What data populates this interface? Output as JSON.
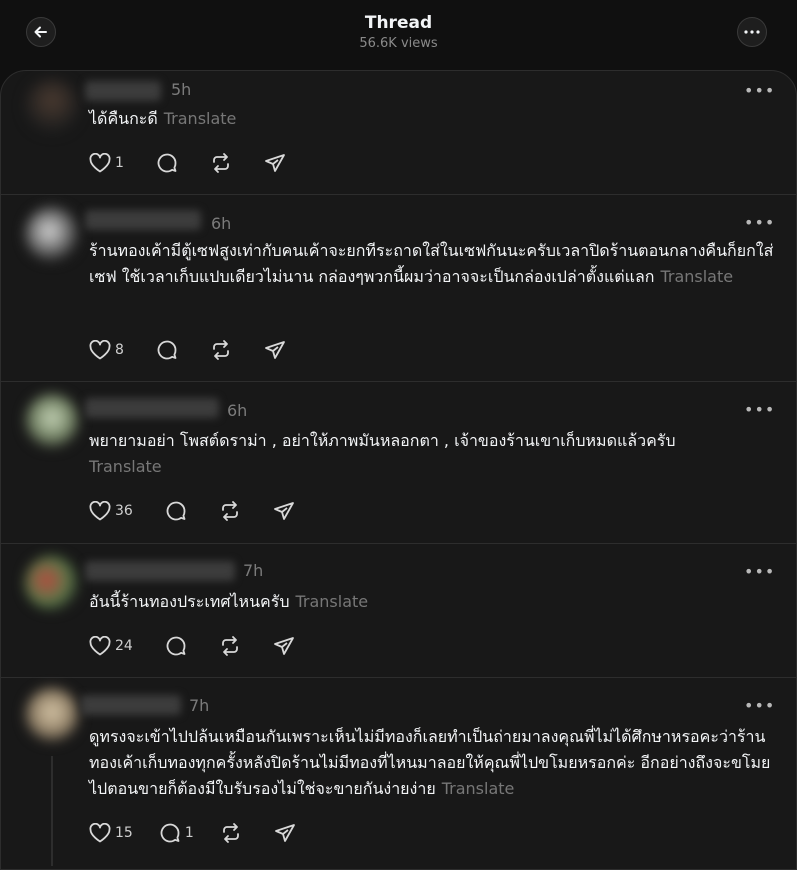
{
  "header": {
    "title": "Thread",
    "views": "56.6K views"
  },
  "icons": {
    "back": "arrow-left-icon",
    "more": "more-horizontal-icon",
    "like": "heart-icon",
    "reply": "comment-icon",
    "repost": "repost-icon",
    "share": "send-icon"
  },
  "colors": {
    "background": "#101010",
    "panel": "#181818",
    "text": "#f3f5f7",
    "muted": "#777777"
  },
  "posts": [
    {
      "time": "5h",
      "text": "ได้คืนกะดี",
      "translate": "Translate",
      "likes": "1",
      "replies": ""
    },
    {
      "time": "6h",
      "text": "ร้านทองเค้ามีตู้เซฟสูงเท่ากับคนเค้าจะยกทีระถาดใส่ในเซฟกันนะครับเวลาปิดร้านตอนกลางคืนก็ยกใส่เซฟ ใช้เวลาเก็บแปบเดียวไม่นาน กล่องๆพวกนี้ผมว่าอาจจะเป็นกล่องเปล่าตั้งแต่แลก",
      "translate": "Translate",
      "likes": "8",
      "replies": ""
    },
    {
      "time": "6h",
      "text": "พยายามอย่า โพสต์ดราม่า , อย่าให้ภาพมันหลอกตา , เจ้าของร้านเขาเก็บหมดแล้วครับ",
      "translate": "Translate",
      "likes": "36",
      "replies": ""
    },
    {
      "time": "7h",
      "text": "อันนี้ร้านทองประเทศไหนครับ",
      "translate": "Translate",
      "likes": "24",
      "replies": ""
    },
    {
      "time": "7h",
      "text": "ดูทรงจะเข้าไปปล้นเหมือนกันเพราะเห็นไม่มีทองก็เลยทำเป็นถ่ายมาลงคุณพี่ไม่ได้ศึกษาหรอคะว่าร้านทองเค้าเก็บทองทุกครั้งหลังปิดร้านไม่มีทองที่ไหนมาลอยให้คุณพี่ไปขโมยหรอกค่ะ อีกอย่างถึงจะขโมยไปตอนขายก็ต้องมีใบรับรองไม่ใช่จะขายกันง่ายง่าย",
      "translate": "Translate",
      "likes": "15",
      "replies": "1"
    }
  ]
}
